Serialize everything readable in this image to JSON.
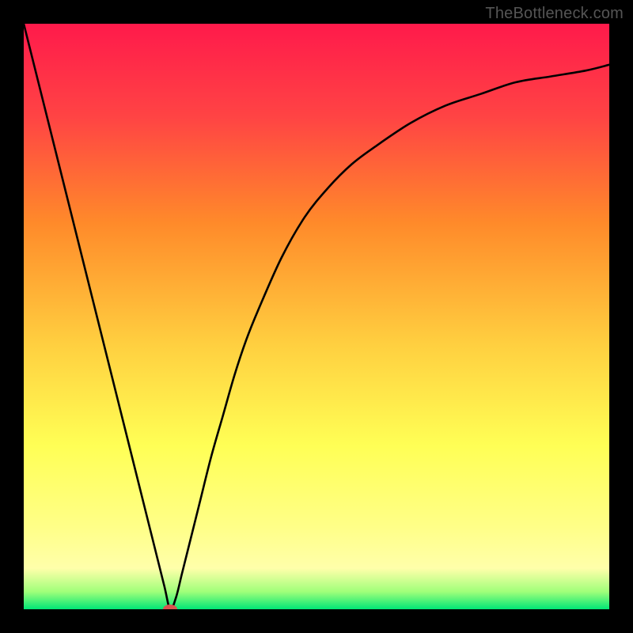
{
  "attribution": "TheBottleneck.com",
  "chart_data": {
    "type": "line",
    "title": "",
    "xlabel": "",
    "ylabel": "",
    "xlim": [
      0,
      100
    ],
    "ylim": [
      0,
      100
    ],
    "grid": false,
    "series": [
      {
        "name": "curve",
        "x": [
          0,
          5,
          10,
          15,
          20,
          22,
          24,
          25,
          26,
          27,
          28,
          30,
          32,
          34,
          36,
          38,
          40,
          44,
          48,
          52,
          56,
          60,
          66,
          72,
          78,
          84,
          90,
          96,
          100
        ],
        "y": [
          100,
          80,
          60,
          40,
          20,
          12,
          4,
          0,
          2,
          6,
          10,
          18,
          26,
          33,
          40,
          46,
          51,
          60,
          67,
          72,
          76,
          79,
          83,
          86,
          88,
          90,
          91,
          92,
          93
        ]
      }
    ],
    "marker": {
      "x": 25,
      "y": 0,
      "color": "#d9534f"
    },
    "background_gradient": {
      "stops": [
        {
          "offset": 0.0,
          "color": "#ff1a4b"
        },
        {
          "offset": 0.16,
          "color": "#ff4444"
        },
        {
          "offset": 0.34,
          "color": "#ff8a2a"
        },
        {
          "offset": 0.55,
          "color": "#ffd040"
        },
        {
          "offset": 0.72,
          "color": "#ffff55"
        },
        {
          "offset": 0.86,
          "color": "#ffff88"
        },
        {
          "offset": 0.93,
          "color": "#ffffaa"
        },
        {
          "offset": 0.97,
          "color": "#a0ff7a"
        },
        {
          "offset": 1.0,
          "color": "#00e676"
        }
      ]
    }
  }
}
